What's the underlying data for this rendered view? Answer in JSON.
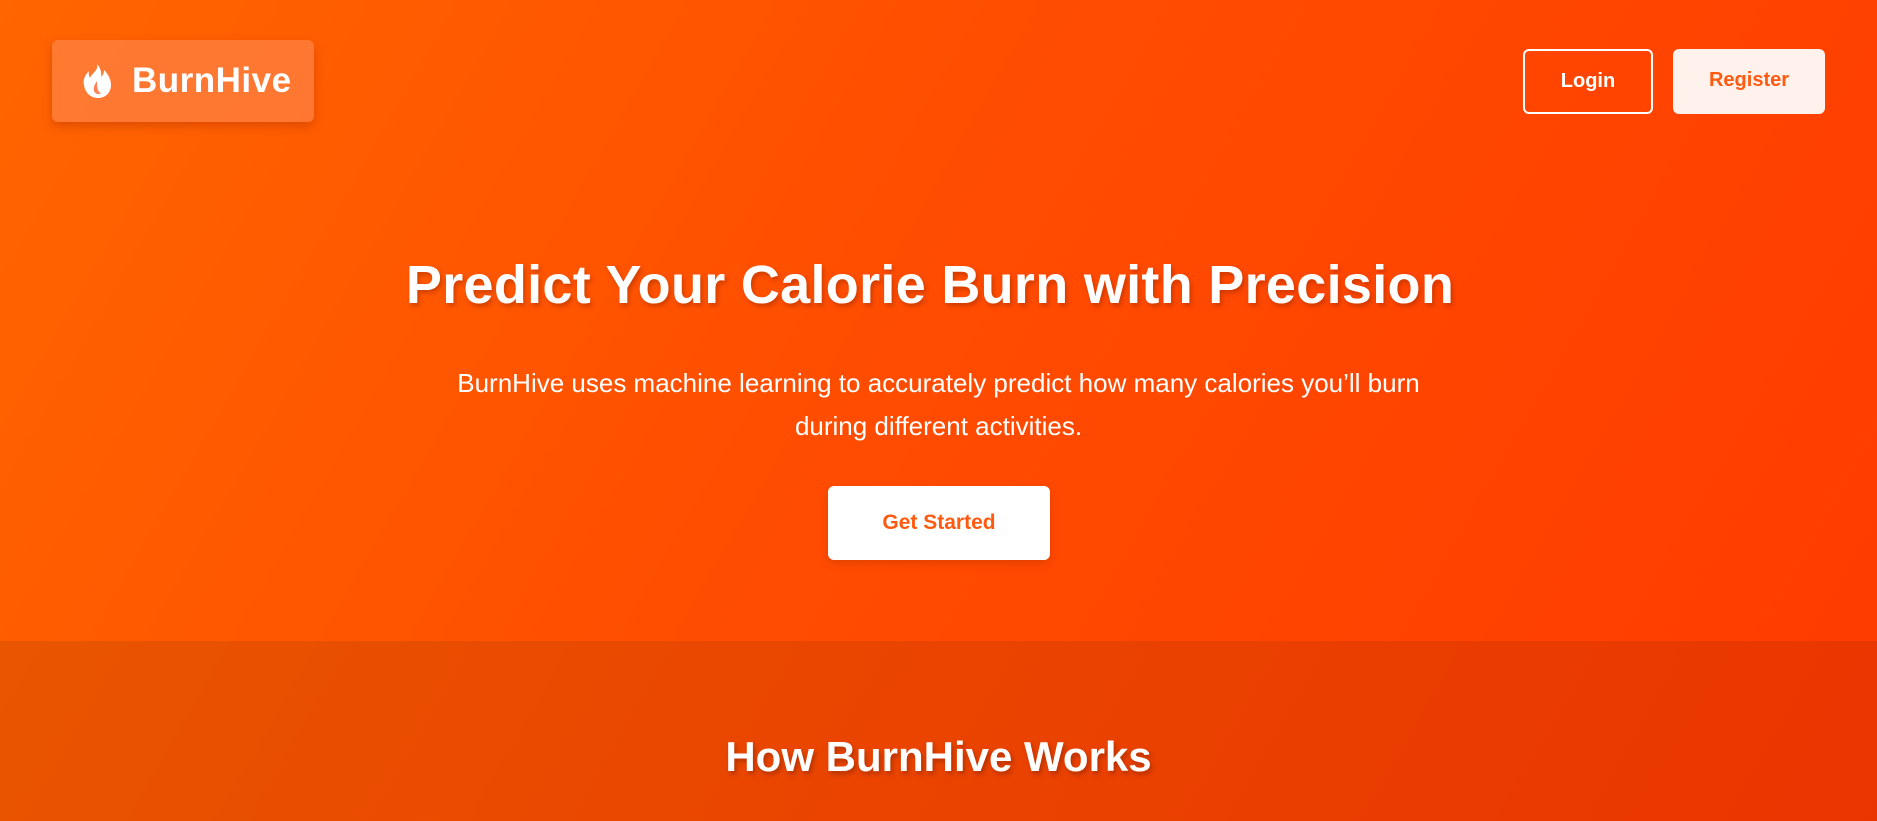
{
  "header": {
    "brand_name": "BurnHive",
    "logo_icon": "flame-icon",
    "login_label": "Login",
    "register_label": "Register"
  },
  "hero": {
    "title": "Predict Your Calorie Burn with Precision",
    "subtitle": "BurnHive uses machine learning to accurately predict how many calories you’ll burn during different activities.",
    "cta_label": "Get Started"
  },
  "how_it_works": {
    "title": "How BurnHive Works"
  },
  "colors": {
    "brand_orange": "#ff5a10",
    "gradient_start": "#ff6500",
    "gradient_end": "#ff3a00",
    "white": "#ffffff"
  }
}
